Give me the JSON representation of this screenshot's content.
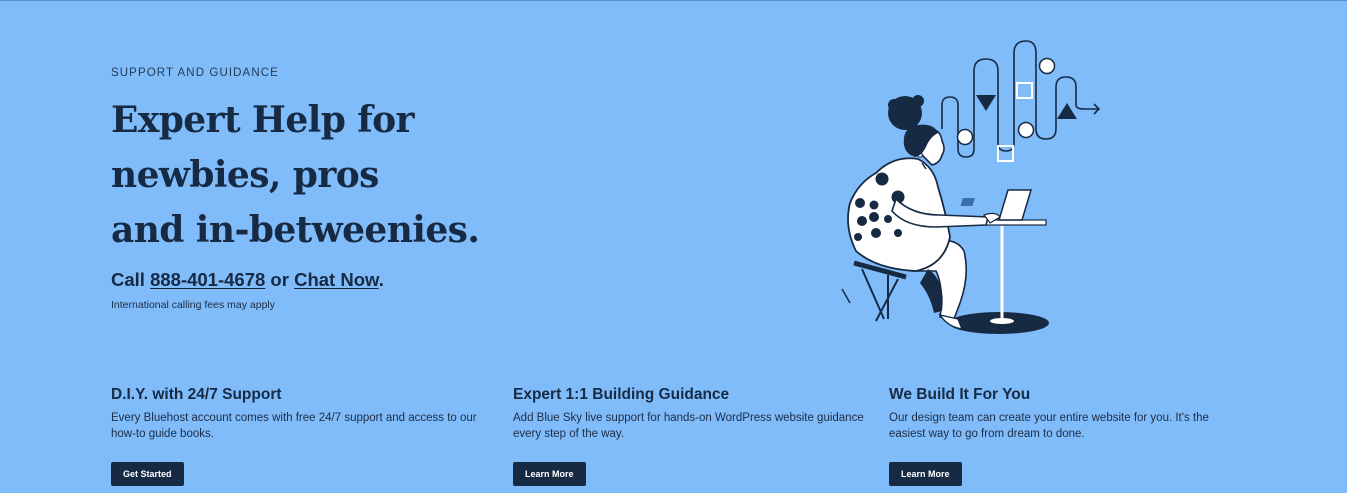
{
  "hero": {
    "eyebrow": "SUPPORT AND GUIDANCE",
    "headline_lines": [
      "Expert Help for",
      "newbies, pros",
      "and in-betweenies."
    ],
    "contact": {
      "prefix": "Call ",
      "phone": "888-401-4678",
      "middle": " or ",
      "chat": "Chat Now",
      "suffix": "."
    },
    "fees_note": "International calling fees may apply"
  },
  "cards": [
    {
      "title": "D.I.Y. with 24/7 Support",
      "text": "Every Bluehost account comes with free 24/7 support and access to our how-to guide books.",
      "button": "Get Started"
    },
    {
      "title": "Expert 1:1 Building Guidance",
      "text": "Add Blue Sky live support for hands-on WordPress website guidance every step of the way.",
      "button": "Learn More"
    },
    {
      "title": "We Build It For You",
      "text": "Our design team can create your entire website for you. It's the easiest way to go from dream to done.",
      "button": "Learn More"
    }
  ],
  "colors": {
    "background": "#81bcfa",
    "text": "#172a44",
    "button": "#172a44",
    "button_text": "#ffffff"
  },
  "illustration": {
    "icon": "woman-at-laptop-illustration"
  }
}
